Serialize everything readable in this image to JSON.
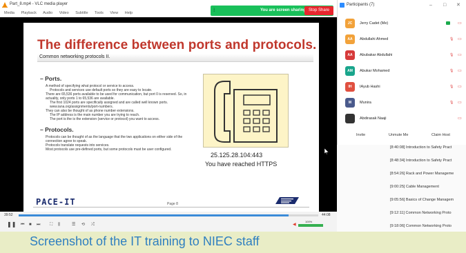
{
  "vlc": {
    "title": "Part_8.mp4 - VLC media player",
    "menu": [
      "Media",
      "Playback",
      "Audio",
      "Video",
      "Subtitle",
      "Tools",
      "View",
      "Help"
    ],
    "time_current": "39:52",
    "time_total": "44:08",
    "progress": 0.9,
    "volume_label": "100%",
    "volume": 1.0
  },
  "share": {
    "status": "You are screen sharing",
    "stop_label": "Stop Share"
  },
  "slide": {
    "title": "The difference between ports and protocols.",
    "subtitle": "Common networking protocols II.",
    "sections": [
      {
        "heading": "– Ports.",
        "bullets": [
          {
            "level": 1,
            "text": "A method of specifying what protocol or service to access."
          },
          {
            "level": 2,
            "text": "Protocols and services use default ports so they are easy to locate."
          },
          {
            "level": 1,
            "text": "There are 65,536 ports available to be used for communication, but port 0 is reserved. So, in actuality, only ports 1 to 65,536 are available."
          },
          {
            "level": 2,
            "text": "The first 1024 ports are specifically assigned and are called well known ports."
          },
          {
            "level": 2,
            "text": "www.iana.org/assignments/port-numbers."
          },
          {
            "level": 1,
            "text": "They can also be thought of as phone number extensions."
          },
          {
            "level": 2,
            "text": "The IP address is the main number you are trying to reach."
          },
          {
            "level": 2,
            "text": "The port is the is the extension (service or protocol) you want to access."
          }
        ]
      },
      {
        "heading": "– Protocols.",
        "bullets": [
          {
            "level": 1,
            "text": "Protocols can be thought of as the language that the two applications on either side of the connection agree to speak."
          },
          {
            "level": 1,
            "text": "Protocols translate requests into services."
          },
          {
            "level": 1,
            "text": "Most protocols use pre-defined ports, but some protocols must be user configured."
          }
        ]
      }
    ],
    "address": "25.125.28.104:443",
    "reached": "You have reached HTTPS",
    "logo": "PACE-IT",
    "page": "Page 8"
  },
  "participants": {
    "title": "Participants (7)",
    "list": [
      {
        "initials": "JC",
        "name": "Jerry Cadet (Me)",
        "color": "#f2a23a",
        "mic": "on",
        "cam": "off"
      },
      {
        "initials": "AA",
        "name": "Abdullahi Ahmed",
        "color": "#f2a23a",
        "mic": "muted",
        "cam": "off"
      },
      {
        "initials": "AA",
        "name": "Abubakar Abdullahi",
        "color": "#d63a3a",
        "mic": "muted",
        "cam": "off"
      },
      {
        "initials": "AM",
        "name": "Abukar Mohamed",
        "color": "#19a58c",
        "mic": "muted",
        "cam": "off"
      },
      {
        "initials": "IH",
        "name": "IAyub Hashi",
        "color": "#e05040",
        "mic": "muted",
        "cam": "off"
      },
      {
        "initials": "M",
        "name": "Munira",
        "color": "#4a5a8c",
        "mic": "muted",
        "cam": "off"
      },
      {
        "initials": "",
        "name": "Abdirasak Naaji",
        "color": "#333333",
        "mic": "",
        "cam": "off"
      }
    ],
    "buttons": [
      "Invite",
      "Unmute Me",
      "Claim Host"
    ]
  },
  "agenda": [
    "[8:40:08] Introduction to Safety Pract",
    "[8:48:34] Introduction to Safety Pract",
    "[8:54:26] Rack and Power Manageme",
    "[9:00:25] Cable Management",
    "[9:05:56] Basics of Change Managem",
    "[9:12:11] Common Networking Proto",
    "[9:18:06] Common Networking Proto"
  ],
  "caption": "Screenshot of the IT training to NIEC staff",
  "colors": {
    "slide_title": "#c0372c",
    "share_green": "#19c05a",
    "stop_red": "#e8262e",
    "caption_text": "#2f7fc0",
    "caption_bg": "#e9edc6"
  }
}
